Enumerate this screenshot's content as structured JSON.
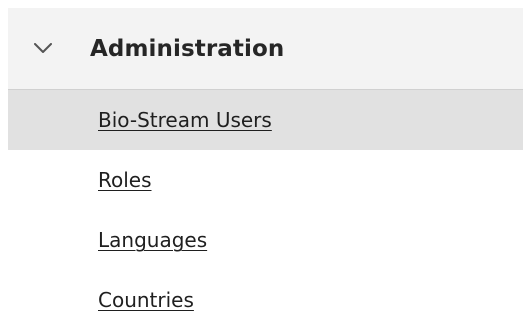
{
  "section": {
    "title": "Administration",
    "icon": "chevron-down-icon",
    "expanded": true
  },
  "items": [
    {
      "label": "Bio-Stream Users",
      "active": true
    },
    {
      "label": "Roles",
      "active": false
    },
    {
      "label": "Languages",
      "active": false
    },
    {
      "label": "Countries",
      "active": false
    }
  ],
  "colors": {
    "header_bg": "#f3f3f3",
    "active_bg": "#e1e1e1",
    "text": "#262626"
  }
}
